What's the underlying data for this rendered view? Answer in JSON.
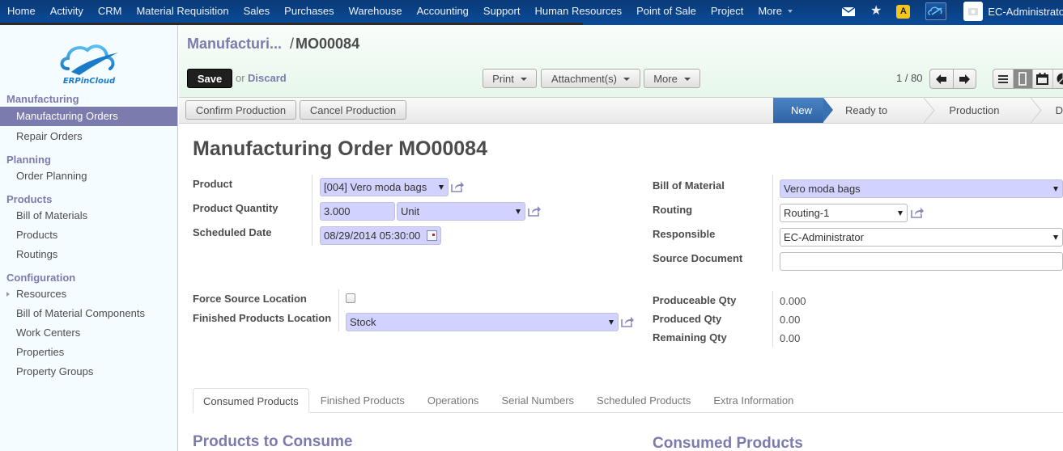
{
  "topnav": {
    "menu": [
      "Home",
      "Activity",
      "CRM",
      "Material Requisition",
      "Sales",
      "Purchases",
      "Warehouse",
      "Accounting",
      "Support",
      "Human Resources",
      "Point of Sale",
      "Project",
      "More"
    ],
    "icons": [
      "mail-icon",
      "star-icon",
      "warning-icon",
      "erp-logo-icon",
      "avatar"
    ],
    "warning_glyph": "A",
    "user": "EC-Administrator"
  },
  "sidebar": {
    "logo_text": "ERPinCloud",
    "sections": [
      {
        "title": "Manufacturing",
        "items": [
          {
            "label": "Manufacturing Orders",
            "active": true
          },
          {
            "label": "Repair Orders"
          }
        ]
      },
      {
        "title": "Planning",
        "items": [
          {
            "label": "Order Planning"
          }
        ]
      },
      {
        "title": "Products",
        "items": [
          {
            "label": "Bill of Materials"
          },
          {
            "label": "Products"
          },
          {
            "label": "Routings"
          }
        ]
      },
      {
        "title": "Configuration",
        "items": [
          {
            "label": "Resources",
            "expandable": true
          },
          {
            "label": "Bill of Material Components"
          },
          {
            "label": "Work Centers"
          },
          {
            "label": "Properties"
          },
          {
            "label": "Property Groups"
          }
        ]
      }
    ]
  },
  "header": {
    "breadcrumb_parent": "Manufacturi...",
    "breadcrumb_separator": "/",
    "breadcrumb_current": "MO00084",
    "save_label": "Save",
    "or_label": "or",
    "discard_label": "Discard",
    "print_label": "Print",
    "attachments_label": "Attachment(s)",
    "more_label": "More",
    "pager": "1 / 80",
    "views": [
      "list-view",
      "form-view",
      "calendar-view",
      "graph-view"
    ],
    "active_view": "form-view"
  },
  "statusbar": {
    "buttons": [
      "Confirm Production",
      "Cancel Production"
    ],
    "steps": [
      "New",
      "Ready to Produce",
      "Production Started",
      "D"
    ],
    "active_step": "New"
  },
  "form": {
    "title_prefix": "Manufacturing Order",
    "title_ref": "MO00084",
    "product_label": "Product",
    "product_value": "[004] Vero moda bags",
    "quantity_label": "Product Quantity",
    "quantity_value": "3.000",
    "uom_value": "Unit",
    "date_label": "Scheduled Date",
    "date_value": "08/29/2014 05:30:00",
    "bom_label": "Bill of Material",
    "bom_value": "Vero moda bags",
    "routing_label": "Routing",
    "routing_value": "Routing-1",
    "responsible_label": "Responsible",
    "responsible_value": "EC-Administrator",
    "source_label": "Source Document",
    "source_value": "",
    "force_source_label": "Force Source Location",
    "force_source_checked": false,
    "finished_loc_label": "Finished Products Location",
    "finished_loc_value": "Stock",
    "produceable_label": "Produceable Qty",
    "produceable_value": "0.000",
    "produced_label": "Produced Qty",
    "produced_value": "0.00",
    "remaining_label": "Remaining Qty",
    "remaining_value": "0.00"
  },
  "tabs": [
    "Consumed Products",
    "Finished Products",
    "Operations",
    "Serial Numbers",
    "Scheduled Products",
    "Extra Information"
  ],
  "active_tab": "Consumed Products",
  "sections": {
    "left": "Products to Consume",
    "right": "Consumed Products"
  },
  "colors": {
    "nav_blue": "#0b4a96",
    "accent_purple": "#7c7bad",
    "required_field": "#d2d2ff",
    "status_active": "#3a71b2"
  }
}
